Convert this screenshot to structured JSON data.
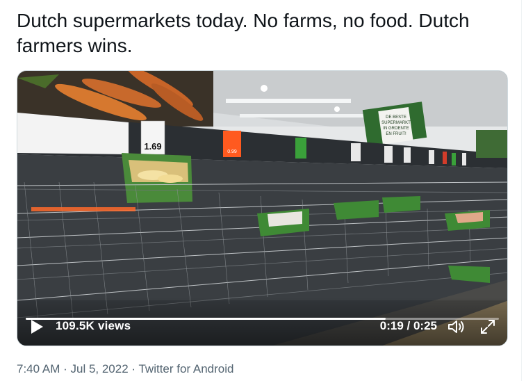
{
  "tweet": {
    "text": "Dutch supermarkets today. No farms, no food. Dutch farmers wins."
  },
  "video": {
    "views": "109.5K views",
    "time": "0:19 / 0:25",
    "progress": 0.76,
    "play_icon": "play-icon",
    "volume_icon": "volume-icon",
    "fullscreen_icon": "fullscreen-icon",
    "shelf_labels": {
      "price_1": "1.69",
      "price_2": "0.99",
      "sign_line_1": "DE BESTE",
      "sign_line_2": "SUPERMARKT",
      "sign_line_3": "IN GROENTE",
      "sign_line_4": "EN FRUIT!"
    }
  },
  "meta": {
    "time": "7:40 AM",
    "separator_1": " · ",
    "date": "Jul 5, 2022",
    "separator_2": " · ",
    "source": "Twitter for Android"
  },
  "colors": {
    "text": "#0f1419",
    "secondary": "#536471",
    "shelf_green": "#2e7d32",
    "price_orange": "#ff5a1f"
  }
}
